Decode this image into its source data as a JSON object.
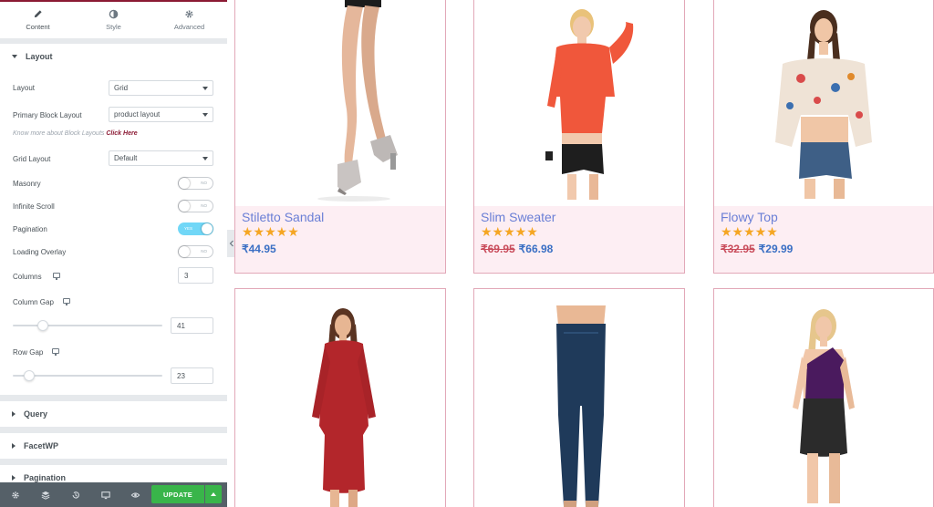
{
  "colors": {
    "accent": "#8b1a34",
    "update_button": "#39b54a",
    "footer": "#556068",
    "switch_on": "#71d7f7",
    "card_border": "#e2a8b8",
    "card_info_bg": "#fdeef3",
    "product_title": "#6a7fd6",
    "star": "#f5a623",
    "old_price": "#c94c5b",
    "new_price": "#3a6fc4"
  },
  "tabs": [
    {
      "label": "Content",
      "icon": "pencil-icon"
    },
    {
      "label": "Style",
      "icon": "contrast-icon"
    },
    {
      "label": "Advanced",
      "icon": "gear-icon"
    }
  ],
  "layout_section": {
    "title": "Layout",
    "layout": {
      "label": "Layout",
      "value": "Grid"
    },
    "primary_block_layout": {
      "label": "Primary Block Layout",
      "value": "product layout"
    },
    "help_text": "Know more about Block Layouts",
    "help_link": "Click Here",
    "grid_layout": {
      "label": "Grid Layout",
      "value": "Default"
    },
    "masonry": {
      "label": "Masonry",
      "state": "NO"
    },
    "infinite_scroll": {
      "label": "Infinite Scroll",
      "state": "NO"
    },
    "pagination": {
      "label": "Pagination",
      "state": "YES"
    },
    "loading_overlay": {
      "label": "Loading Overlay",
      "state": "NO"
    },
    "columns": {
      "label": "Columns",
      "value": "3"
    },
    "column_gap": {
      "label": "Column Gap",
      "value": "41",
      "level_percent": 20
    },
    "row_gap": {
      "label": "Row Gap",
      "value": "23",
      "level_percent": 11
    }
  },
  "sections": {
    "query": "Query",
    "facetwp": "FacetWP",
    "pagination": "Pagination"
  },
  "footer": {
    "icons": [
      "settings-icon",
      "layers-icon",
      "history-icon",
      "responsive-icon",
      "preview-eye-icon"
    ],
    "update_label": "UPDATE"
  },
  "products": [
    {
      "title": "Stiletto Sandal",
      "stars": "★★★★★",
      "old_price": "",
      "price": "₹44.95"
    },
    {
      "title": "Slim Sweater",
      "stars": "★★★★★",
      "old_price": "₹69.95",
      "price": "₹66.98"
    },
    {
      "title": "Flowy Top",
      "stars": "★★★★★",
      "old_price": "₹32.95",
      "price": "₹29.99"
    }
  ]
}
